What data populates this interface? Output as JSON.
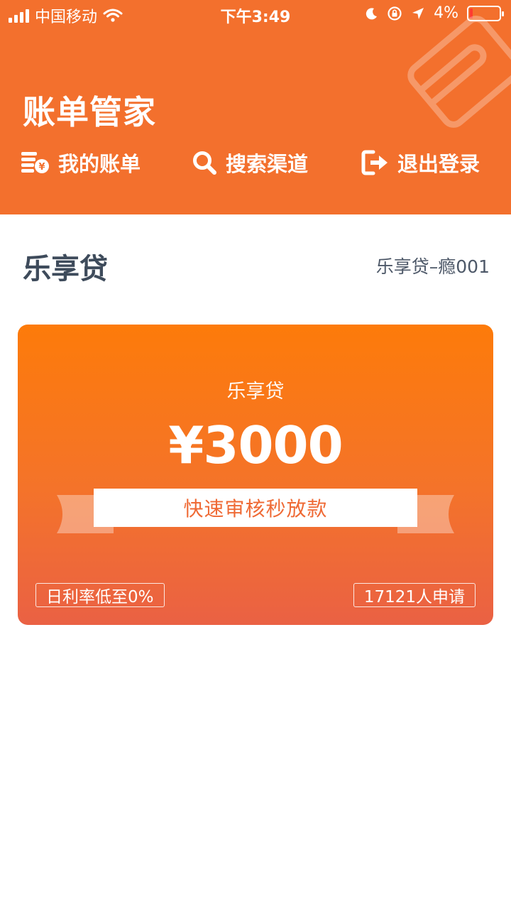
{
  "status_bar": {
    "carrier": "中国移动",
    "time": "下午3:49",
    "battery_text": "4%"
  },
  "header": {
    "title": "账单管家",
    "nav": [
      {
        "label": "我的账单",
        "icon": "bill-coins-icon"
      },
      {
        "label": "搜索渠道",
        "icon": "search-icon"
      },
      {
        "label": "退出登录",
        "icon": "logout-icon"
      }
    ],
    "color": "#f3702d"
  },
  "section": {
    "title": "乐享贷",
    "subtitle": "乐享贷–瘾001"
  },
  "card": {
    "name": "乐享贷",
    "amount": "¥3000",
    "slogan": "快速审核秒放款",
    "tag_left": "日利率低至0%",
    "tag_right": "17121人申请",
    "gradient_top": "#fd7b0a",
    "gradient_bottom": "#ea6144"
  }
}
